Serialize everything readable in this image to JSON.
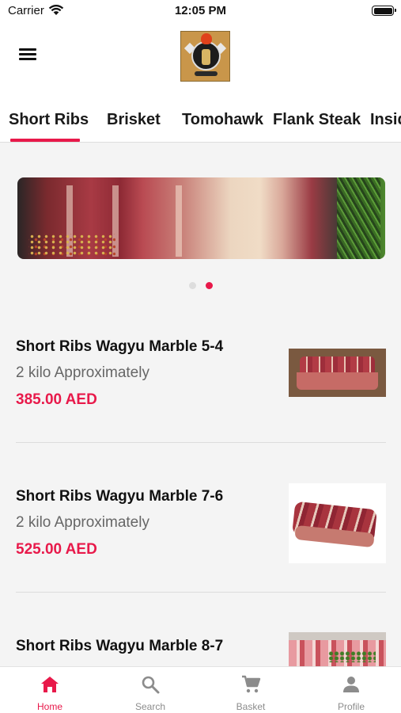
{
  "status_bar": {
    "carrier": "Carrier",
    "time": "12:05 PM"
  },
  "header": {
    "menu_icon": "hamburger-menu-icon",
    "logo": "brand-logo"
  },
  "tabs": [
    {
      "label": "Short Ribs",
      "active": true
    },
    {
      "label": "Brisket",
      "active": false
    },
    {
      "label": "Tomohawk",
      "active": false
    },
    {
      "label": "Flank Steak",
      "active": false
    },
    {
      "label": "Inside",
      "active": false
    }
  ],
  "carousel": {
    "slide_count": 2,
    "active_index": 1
  },
  "products": [
    {
      "name": "Short Ribs Wagyu Marble 5-4",
      "description": "2 kilo Approximately",
      "price": "385.00 AED"
    },
    {
      "name": "Short Ribs Wagyu Marble 7-6",
      "description": "2 kilo Approximately",
      "price": "525.00 AED"
    },
    {
      "name": "Short Ribs Wagyu Marble 8-7",
      "description": "",
      "price": ""
    }
  ],
  "bottom_nav": [
    {
      "label": "Home",
      "icon": "home-icon",
      "active": true
    },
    {
      "label": "Search",
      "icon": "search-icon",
      "active": false
    },
    {
      "label": "Basket",
      "icon": "cart-icon",
      "active": false
    },
    {
      "label": "Profile",
      "icon": "person-icon",
      "active": false
    }
  ],
  "colors": {
    "accent": "#e8194a",
    "inactive_nav": "#8c8c8c",
    "background": "#f4f4f4"
  }
}
